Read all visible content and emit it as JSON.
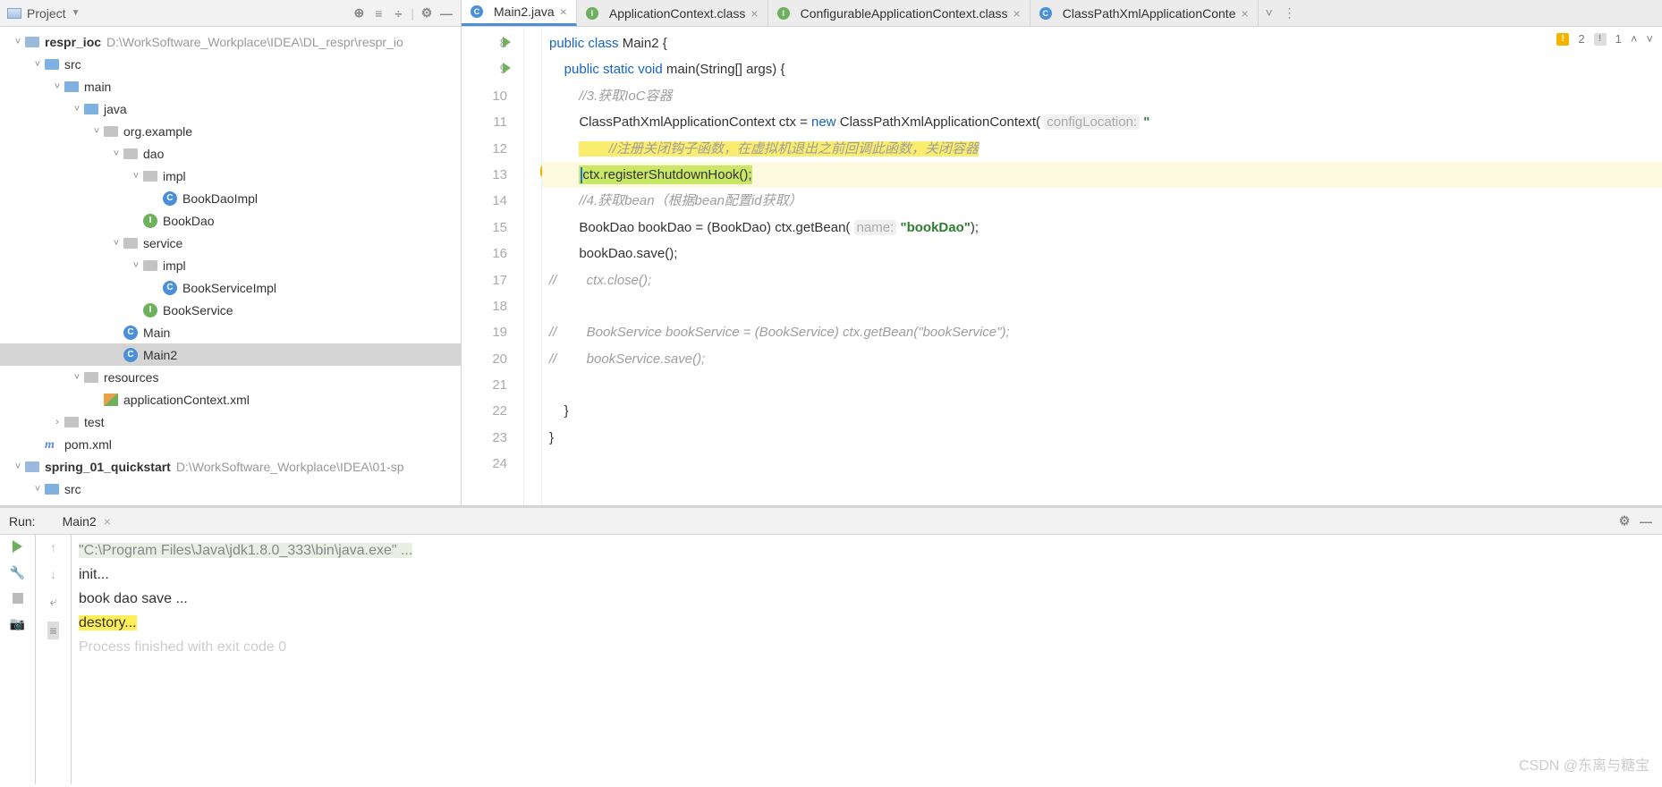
{
  "sidebar": {
    "title": "Project",
    "tools": [
      "⊕",
      "≡",
      "÷",
      "⚙",
      "—"
    ],
    "tree": [
      {
        "indent": 0,
        "arrow": "˅",
        "icon": "mod",
        "name": "respr_ioc",
        "path": "D:\\WorkSoftware_Workplace\\IDEA\\DL_respr\\respr_io",
        "bold": true
      },
      {
        "indent": 1,
        "arrow": "˅",
        "icon": "folder-blue",
        "name": "src"
      },
      {
        "indent": 2,
        "arrow": "˅",
        "icon": "folder-blue",
        "name": "main"
      },
      {
        "indent": 3,
        "arrow": "˅",
        "icon": "folder-blue",
        "name": "java"
      },
      {
        "indent": 4,
        "arrow": "˅",
        "icon": "folder-grey",
        "name": "org.example"
      },
      {
        "indent": 5,
        "arrow": "˅",
        "icon": "folder-grey",
        "name": "dao"
      },
      {
        "indent": 6,
        "arrow": "˅",
        "icon": "folder-grey",
        "name": "impl"
      },
      {
        "indent": 7,
        "arrow": "",
        "icon": "c",
        "name": "BookDaoImpl"
      },
      {
        "indent": 6,
        "arrow": "",
        "icon": "i",
        "name": "BookDao"
      },
      {
        "indent": 5,
        "arrow": "˅",
        "icon": "folder-grey",
        "name": "service"
      },
      {
        "indent": 6,
        "arrow": "˅",
        "icon": "folder-grey",
        "name": "impl"
      },
      {
        "indent": 7,
        "arrow": "",
        "icon": "c",
        "name": "BookServiceImpl"
      },
      {
        "indent": 6,
        "arrow": "",
        "icon": "i",
        "name": "BookService"
      },
      {
        "indent": 5,
        "arrow": "",
        "icon": "c",
        "name": "Main"
      },
      {
        "indent": 5,
        "arrow": "",
        "icon": "c",
        "name": "Main2",
        "sel": true
      },
      {
        "indent": 3,
        "arrow": "˅",
        "icon": "folder-grey",
        "name": "resources"
      },
      {
        "indent": 4,
        "arrow": "",
        "icon": "xml",
        "name": "applicationContext.xml"
      },
      {
        "indent": 2,
        "arrow": "›",
        "icon": "folder-grey",
        "name": "test"
      },
      {
        "indent": 1,
        "arrow": "",
        "icon": "m",
        "name": "pom.xml"
      },
      {
        "indent": 0,
        "arrow": "˅",
        "icon": "mod",
        "name": "spring_01_quickstart",
        "path": "D:\\WorkSoftware_Workplace\\IDEA\\01-sp",
        "bold": true
      },
      {
        "indent": 1,
        "arrow": "˅",
        "icon": "folder-blue",
        "name": "src"
      }
    ]
  },
  "tabs": [
    {
      "icon": "c",
      "label": "Main2.java",
      "active": true
    },
    {
      "icon": "i",
      "label": "ApplicationContext.class"
    },
    {
      "icon": "i",
      "label": "ConfigurableApplicationContext.class"
    },
    {
      "icon": "c",
      "label": "ClassPathXmlApplicationConte"
    }
  ],
  "inspections": {
    "warn": "2",
    "weak": "1"
  },
  "gutter": [
    "8",
    "9",
    "10",
    "11",
    "12",
    "13",
    "14",
    "15",
    "16",
    "17",
    "18",
    "19",
    "20",
    "21",
    "22",
    "23",
    "24"
  ],
  "code": {
    "hint_config": "configLocation:",
    "hint_name": "name:",
    "l8": "public class Main2 {",
    "l9": "    public static void main(String[] args) {",
    "l10": "        //3.获取IoC容器",
    "l11_a": "        ClassPathXmlApplicationContext ctx = ",
    "l11_b": "new",
    "l11_c": " ClassPathXmlApplicationContext( ",
    "l11_d": " \"",
    "l12": "        //注册关闭钩子函数，在虚拟机退出之前回调此函数，关闭容器",
    "l13": "        ctx.registerShutdownHook();",
    "l14": "        //4.获取bean（根据bean配置id获取）",
    "l15_a": "        BookDao bookDao = (BookDao) ctx.getBean( ",
    "l15_b": "\"bookDao\"",
    "l15_c": ");",
    "l16": "        bookDao.save();",
    "l17": "//        ctx.close();",
    "l18": "",
    "l19": "//        BookService bookService = (BookService) ctx.getBean(\"bookService\");",
    "l20": "//        bookService.save();",
    "l21": "",
    "l22": "    }",
    "l23": "}"
  },
  "run": {
    "label": "Run:",
    "config": "Main2",
    "out": {
      "cmd": "\"C:\\Program Files\\Java\\jdk1.8.0_333\\bin\\java.exe\" ...",
      "l1": "init...",
      "l2": "book dao save ...",
      "l3": "destory...",
      "l4": "",
      "l5": "Process finished with exit code 0"
    }
  },
  "watermark": "CSDN @东离与糖宝"
}
